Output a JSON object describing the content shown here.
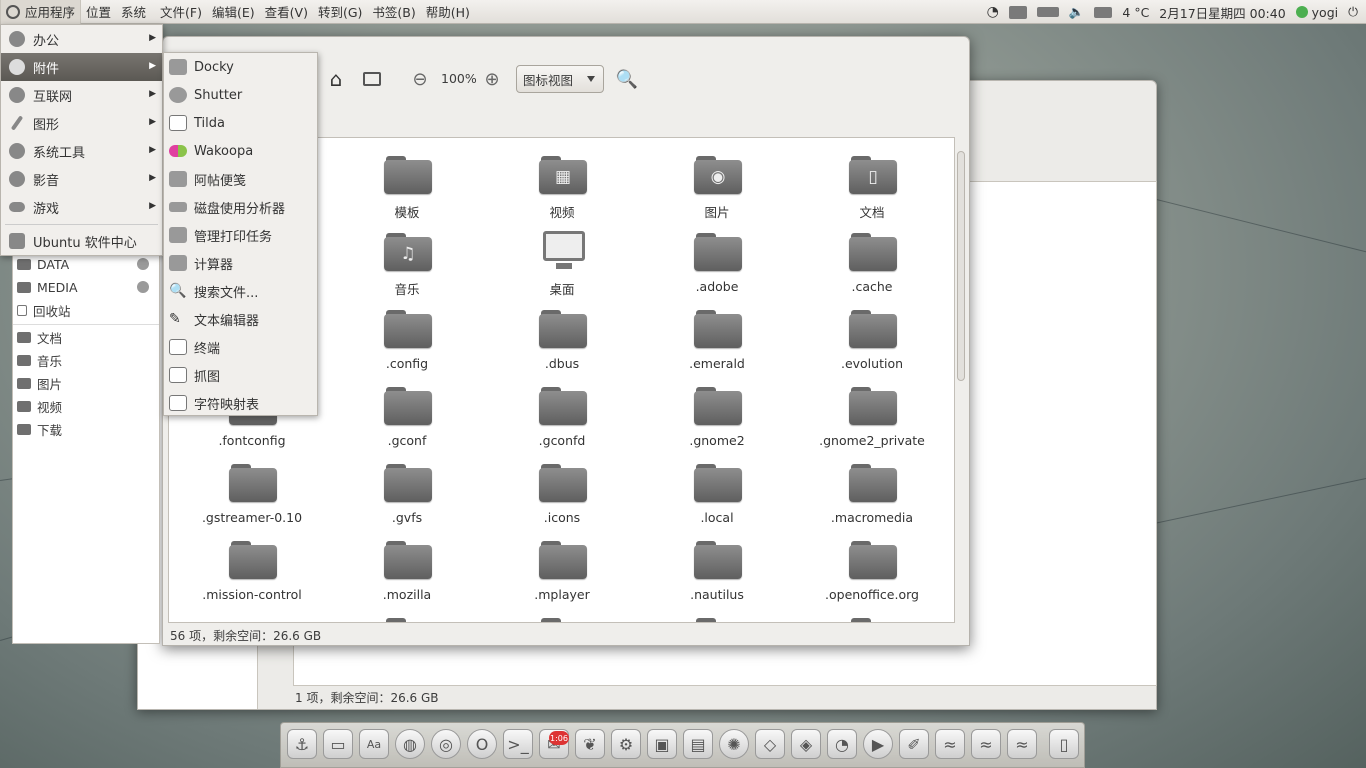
{
  "topbar": {
    "menus": [
      "应用程序",
      "位置",
      "系统",
      "文件(F)",
      "编辑(E)",
      "查看(V)",
      "转到(G)",
      "书签(B)",
      "帮助(H)"
    ],
    "temperature": "4 °C",
    "datetime": "2月17日星期四 00:40",
    "user": "yogi"
  },
  "apps_menu": {
    "items": [
      {
        "label": "办公",
        "submenu": true
      },
      {
        "label": "附件",
        "submenu": true,
        "selected": true
      },
      {
        "label": "互联网",
        "submenu": true
      },
      {
        "label": "图形",
        "submenu": true
      },
      {
        "label": "系统工具",
        "submenu": true
      },
      {
        "label": "影音",
        "submenu": true
      },
      {
        "label": "游戏",
        "submenu": true
      },
      {
        "label": "Ubuntu 软件中心",
        "submenu": false
      }
    ]
  },
  "accessories_menu": {
    "items": [
      "Docky",
      "Shutter",
      "Tilda",
      "Wakoopa",
      "阿帖便笺",
      "磁盘使用分析器",
      "管理打印任务",
      "计算器",
      "搜索文件...",
      "文本编辑器",
      "终端",
      "抓图",
      "字符映射表"
    ]
  },
  "file_manager": {
    "zoom": "100%",
    "view_mode": "图标视图",
    "status": "56 项，剩余空间：26.6 GB",
    "items": [
      ".fontconfig",
      ".gconf",
      ".gconfd",
      ".gnome2",
      ".gnome2_private",
      ".gstreamer-0.10",
      ".gvfs",
      ".icons",
      ".local",
      ".macromedia",
      ".mission-control",
      ".mozilla",
      ".mplayer",
      ".nautilus",
      ".openoffice.org"
    ],
    "top_items": [
      {
        "label": "模板",
        "glyph": ""
      },
      {
        "label": "视频",
        "glyph": "▦"
      },
      {
        "label": "图片",
        "glyph": "◉"
      },
      {
        "label": "文档",
        "glyph": "▯"
      },
      {
        "label": "音乐",
        "glyph": "♫"
      },
      {
        "label": "桌面",
        "glyph": "monitor"
      },
      {
        "label": ".adobe",
        "glyph": ""
      },
      {
        "label": ".cache",
        "glyph": ""
      },
      {
        "label": ".config",
        "glyph": ""
      },
      {
        "label": ".dbus",
        "glyph": ""
      },
      {
        "label": ".emerald",
        "glyph": ""
      },
      {
        "label": ".evolution",
        "glyph": ""
      }
    ]
  },
  "sidebar": {
    "devices": [
      "DATA",
      "MEDIA",
      "回收站"
    ],
    "places": [
      "文档",
      "音乐",
      "图片",
      "视频",
      "下载"
    ]
  },
  "back_window": {
    "status": "1 项，剩余空间：26.6 GB"
  },
  "dock": {
    "badge": "1:06"
  }
}
